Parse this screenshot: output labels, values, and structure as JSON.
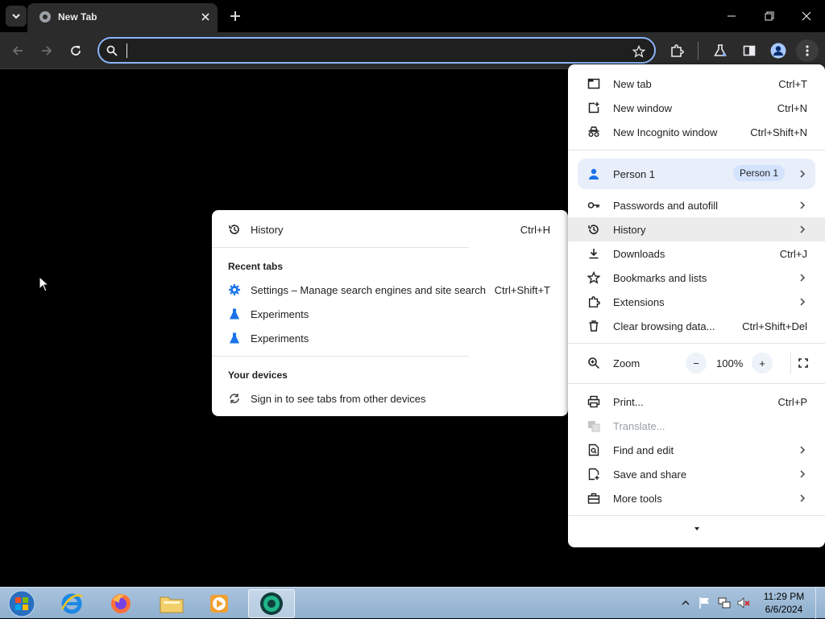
{
  "browser": {
    "tab_title": "New Tab",
    "omnibox_value": ""
  },
  "main_menu": {
    "items": [
      {
        "label": "New tab",
        "shortcut": "Ctrl+T",
        "icon": "new-tab-icon"
      },
      {
        "label": "New window",
        "shortcut": "Ctrl+N",
        "icon": "new-window-icon"
      },
      {
        "label": "New Incognito window",
        "shortcut": "Ctrl+Shift+N",
        "icon": "incognito-icon"
      }
    ],
    "profile": {
      "label": "Person 1",
      "badge": "Person 1",
      "icon": "person-icon"
    },
    "items2": [
      {
        "label": "Passwords and autofill",
        "icon": "key-icon"
      },
      {
        "label": "History",
        "icon": "history-icon"
      },
      {
        "label": "Downloads",
        "shortcut": "Ctrl+J",
        "icon": "download-icon"
      },
      {
        "label": "Bookmarks and lists",
        "icon": "star-icon"
      },
      {
        "label": "Extensions",
        "icon": "puzzle-icon"
      },
      {
        "label": "Clear browsing data...",
        "shortcut": "Ctrl+Shift+Del",
        "icon": "trash-icon"
      }
    ],
    "zoom": {
      "label": "Zoom",
      "value": "100%",
      "minus": "−",
      "plus": "+"
    },
    "items3": [
      {
        "label": "Print...",
        "shortcut": "Ctrl+P",
        "icon": "print-icon"
      },
      {
        "label": "Translate...",
        "icon": "translate-icon"
      },
      {
        "label": "Find and edit",
        "icon": "find-icon"
      },
      {
        "label": "Save and share",
        "icon": "save-share-icon"
      },
      {
        "label": "More tools",
        "icon": "toolbox-icon"
      }
    ]
  },
  "history_menu": {
    "history": {
      "label": "History",
      "shortcut": "Ctrl+H"
    },
    "recent_heading": "Recent tabs",
    "recent": [
      {
        "label": "Settings – Manage search engines and site search",
        "shortcut": "Ctrl+Shift+T",
        "icon": "settings-gear-icon"
      },
      {
        "label": "Experiments",
        "icon": "flask-icon"
      },
      {
        "label": "Experiments",
        "icon": "flask-icon"
      }
    ],
    "devices_heading": "Your devices",
    "devices_item": "Sign in to see tabs from other devices"
  },
  "taskbar": {
    "time": "11:29 PM",
    "date": "6/6/2024"
  },
  "colors": {
    "accent": "#8ab4f8",
    "menu_bg": "#ffffff",
    "icon_blue": "#1a73e8"
  }
}
